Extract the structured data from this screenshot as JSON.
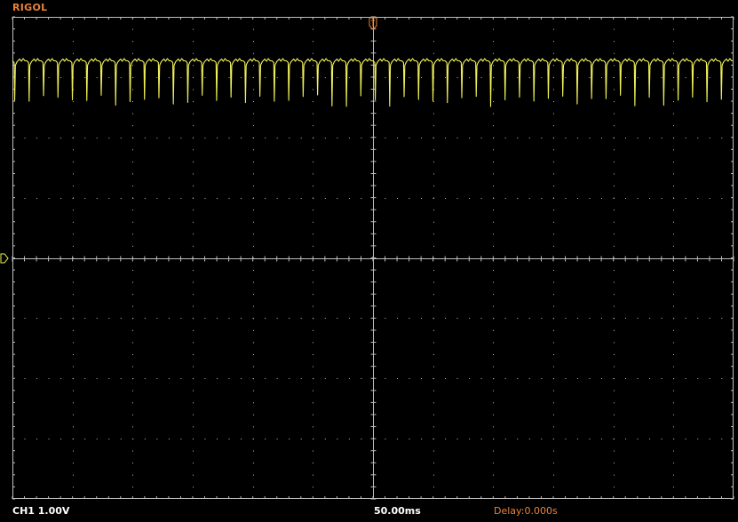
{
  "brand": "RIGOL",
  "status_bar": {
    "channel": "CH1 1.00V",
    "timebase": "50.00ms",
    "delay": "Delay:0.000s"
  },
  "colors": {
    "background": "#000000",
    "grid": "#bfbfbf",
    "trace": "#f2f25a",
    "brand": "#e8843a",
    "delay_text": "#e8843a",
    "status_text": "#ffffff"
  },
  "icons": {
    "trigger_position_marker": "trigger-t-marker-icon",
    "channel_ground_marker": "ground-marker-icon"
  },
  "grid": {
    "horizontal_divisions": 12,
    "vertical_divisions": 8,
    "subdivisions": 5
  },
  "waveform": {
    "channel": "CH1",
    "pulse_count": 50,
    "high_level_div": 3.3,
    "low_level_div": 2.7
  }
}
